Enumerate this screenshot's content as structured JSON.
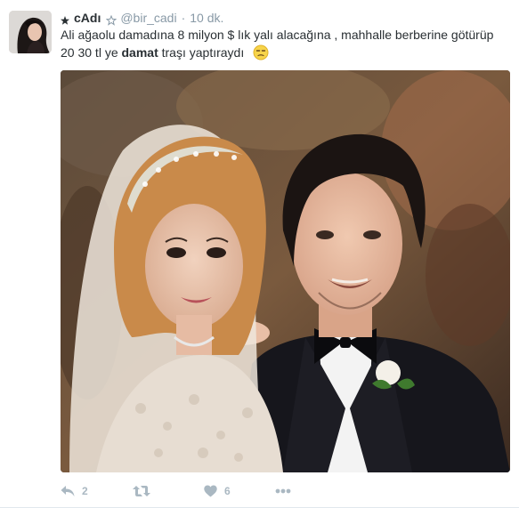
{
  "tweet": {
    "display_name": "cAdı",
    "username": "@bir_cadi",
    "separator": "·",
    "time": "10 dk.",
    "text_line1": "Ali ağaolu damadına 8 milyon $ lık yalı alacağına , mahhalle berberine götürüp",
    "text_line2_a": "20 30 tl ye",
    "text_line2_bold": "damat",
    "text_line2_b": "traşı yaptıraydı"
  },
  "actions": {
    "reply_count": "2",
    "like_count": "6"
  },
  "icons": {
    "star": "star-icon",
    "emoji": "unamused-face-emoji",
    "reply": "reply-icon",
    "retweet": "retweet-icon",
    "like": "heart-icon",
    "more": "more-dots-icon"
  },
  "colors": {
    "text": "#292f33",
    "muted": "#8899a6",
    "action": "#aab8c2"
  }
}
